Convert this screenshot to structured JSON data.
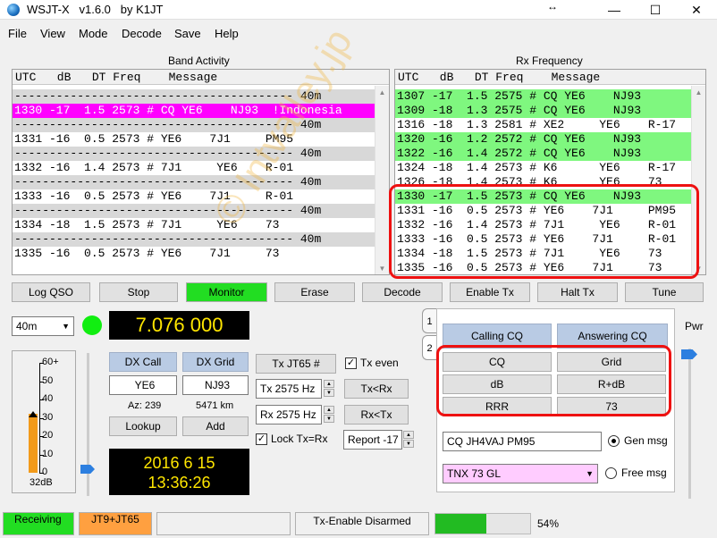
{
  "window": {
    "title": "WSJT-X   v1.6.0   by K1JT",
    "min": "—",
    "max": "☐",
    "close": "✕",
    "resize_glyph": "↔"
  },
  "menu": [
    "File",
    "View",
    "Mode",
    "Decode",
    "Save",
    "Help"
  ],
  "band_activity": {
    "title": "Band Activity",
    "header": "UTC   dB   DT Freq    Message",
    "rows": [
      {
        "text": "---------------------------------------- 40m",
        "style": "sep"
      },
      {
        "text": "1330 -17  1.5 2573 # CQ YE6    NJ93  !Indonesia",
        "style": "hl-magenta"
      },
      {
        "text": "---------------------------------------- 40m",
        "style": "sep"
      },
      {
        "text": "1331 -16  0.5 2573 # YE6    7J1     PM95",
        "style": ""
      },
      {
        "text": "---------------------------------------- 40m",
        "style": "sep"
      },
      {
        "text": "1332 -16  1.4 2573 # 7J1     YE6    R-01",
        "style": ""
      },
      {
        "text": "---------------------------------------- 40m",
        "style": "sep"
      },
      {
        "text": "1333 -16  0.5 2573 # YE6    7J1     R-01",
        "style": ""
      },
      {
        "text": "---------------------------------------- 40m",
        "style": "sep"
      },
      {
        "text": "1334 -18  1.5 2573 # 7J1     YE6    73",
        "style": ""
      },
      {
        "text": "---------------------------------------- 40m",
        "style": "sep"
      },
      {
        "text": "1335 -16  0.5 2573 # YE6    7J1     73",
        "style": ""
      }
    ]
  },
  "rx_frequency": {
    "title": "Rx Frequency",
    "header": "UTC   dB   DT Freq    Message",
    "rows": [
      {
        "text": "1307 -17  1.5 2575 # CQ YE6    NJ93",
        "style": "hl-green"
      },
      {
        "text": "1309 -18  1.3 2575 # CQ YE6    NJ93",
        "style": "hl-green"
      },
      {
        "text": "1316 -18  1.3 2581 # XE2     YE6    R-17",
        "style": ""
      },
      {
        "text": "1320 -16  1.2 2572 # CQ YE6    NJ93",
        "style": "hl-green"
      },
      {
        "text": "1322 -16  1.4 2572 # CQ YE6    NJ93",
        "style": "hl-green"
      },
      {
        "text": "1324 -18  1.4 2573 # K6      YE6    R-17",
        "style": ""
      },
      {
        "text": "1326 -18  1.4 2573 # K6      YE6    73",
        "style": ""
      },
      {
        "text": "1330 -17  1.5 2573 # CQ YE6    NJ93",
        "style": "hl-green"
      },
      {
        "text": "1331 -16  0.5 2573 # YE6    7J1     PM95",
        "style": ""
      },
      {
        "text": "1332 -16  1.4 2573 # 7J1     YE6    R-01",
        "style": ""
      },
      {
        "text": "1333 -16  0.5 2573 # YE6    7J1     R-01",
        "style": ""
      },
      {
        "text": "1334 -18  1.5 2573 # 7J1     YE6    73",
        "style": ""
      },
      {
        "text": "1335 -16  0.5 2573 # YE6    7J1     73",
        "style": ""
      }
    ],
    "highlight_box_color": "#ee1111"
  },
  "control_buttons": {
    "log_qso": "Log QSO",
    "stop": "Stop",
    "monitor": "Monitor",
    "erase": "Erase",
    "decode": "Decode",
    "enable_tx": "Enable Tx",
    "halt_tx": "Halt Tx",
    "tune": "Tune"
  },
  "band_select": {
    "value": "40m"
  },
  "frequency": "7.076 000",
  "level_meter": {
    "ticks": [
      "60+",
      "50",
      "40",
      "30",
      "20",
      "10",
      "0"
    ],
    "db_label": "32dB",
    "level_db": 32
  },
  "dx": {
    "call_label": "DX Call",
    "grid_label": "DX Grid",
    "call_value": "YE6",
    "grid_value": "NJ93",
    "az": "Az: 239",
    "distance": "5471 km",
    "lookup": "Lookup",
    "add": "Add"
  },
  "datetime": {
    "date": "2016 6 15",
    "time": "13:36:26"
  },
  "tx_controls": {
    "tx_mode": "Tx JT65  #",
    "tx_even": "Tx even",
    "tx_even_checked": true,
    "tx_freq": "Tx  2575  Hz",
    "tx_rx_btn": "Tx<Rx",
    "rx_freq": "Rx  2575  Hz",
    "rx_tx_btn": "Rx<Tx",
    "lock": "Lock Tx=Rx",
    "lock_checked": true,
    "report": "Report -17"
  },
  "tabs": [
    "1",
    "2"
  ],
  "messages": {
    "calling_cq": "Calling CQ",
    "answering_cq": "Answering CQ",
    "cq": "CQ",
    "grid": "Grid",
    "db": "dB",
    "rdb": "R+dB",
    "rrr": "RRR",
    "seventy_three": "73",
    "gen_msg_value": "CQ JH4VAJ PM95",
    "gen_msg_label": "Gen msg",
    "free_msg_value": "TNX 73 GL",
    "free_msg_label": "Free msg",
    "highlight_box_color": "#ee1111"
  },
  "pwr_label": "Pwr",
  "status_bar": {
    "receiving": "Receiving",
    "mode": "JT9+JT65",
    "empty": "",
    "tx_enable": "Tx-Enable Disarmed",
    "progress_percent": 54,
    "progress_label": "54%"
  },
  "watermark": "© Intvalley.jp",
  "colors": {
    "receiving_bg": "#22dd22",
    "mode_bg": "#ffa040",
    "progress": "#22bb22"
  }
}
